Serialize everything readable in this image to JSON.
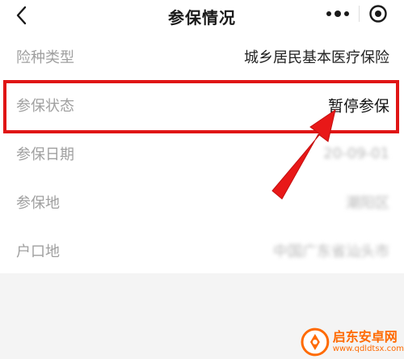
{
  "header": {
    "title": "参保情况",
    "back_icon": "chevron-left-icon",
    "more_icon": "more-dots-icon",
    "close_icon": "target-close-icon"
  },
  "rows": [
    {
      "label": "险种类型",
      "value": "城乡居民基本医疗保险"
    },
    {
      "label": "参保状态",
      "value": "暂停参保"
    },
    {
      "label": "参保日期",
      "value": "20-09-01"
    },
    {
      "label": "参保地",
      "value": "潮阳区"
    },
    {
      "label": "户口地",
      "value": "中国广东省汕头市"
    }
  ],
  "watermark": {
    "title": "启东安卓网",
    "url": "www.qdldtsx.com"
  },
  "colors": {
    "highlight": "#e01515",
    "label": "#a0a0a0",
    "value": "#222222",
    "watermark": "#ff6a00"
  }
}
